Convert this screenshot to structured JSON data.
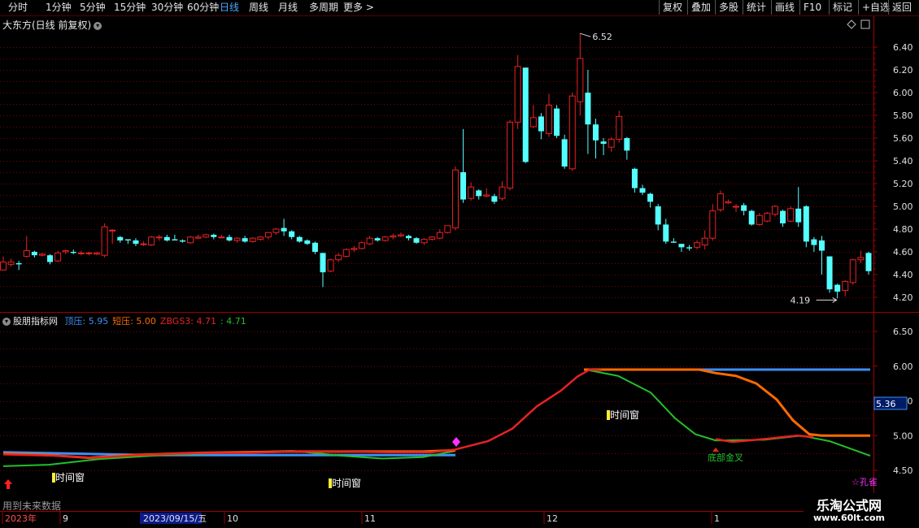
{
  "toolbar": {
    "periods": [
      "分时",
      "1分钟",
      "5分钟",
      "15分钟",
      "30分钟",
      "60分钟",
      "日线",
      "周线",
      "月线",
      "多周期",
      "更多 >"
    ],
    "active_period": "日线",
    "right_buttons": [
      "复权",
      "叠加",
      "多股",
      "统计",
      "画线",
      "F10",
      "标记",
      "+自选",
      "返回"
    ]
  },
  "stock": {
    "title": "大东方(日线 前复权)",
    "high_label": "6.52",
    "low_label": "4.19"
  },
  "price_axis": [
    "6.40",
    "6.20",
    "6.00",
    "5.80",
    "5.60",
    "5.40",
    "5.20",
    "5.00",
    "4.80",
    "4.60",
    "4.40",
    "4.20"
  ],
  "indicator": {
    "name": "股朋指标网",
    "items": [
      {
        "label": "顶压:",
        "value": "5.95",
        "color": "#3d8ff5"
      },
      {
        "label": "短压:",
        "value": "5.00",
        "color": "#ff6a00"
      },
      {
        "label": "ZBGS3:",
        "value": "4.71",
        "color": "#e82222"
      },
      {
        "label": ":",
        "value": "4.71",
        "color": "#22c02a"
      }
    ],
    "axis": [
      "6.50",
      "6.00",
      "5.50",
      "5.00",
      "4.50"
    ],
    "current_value": "5.36",
    "annotations": [
      "时间窗",
      "时间窗",
      "时间窗",
      "底部金叉",
      "孔雀"
    ]
  },
  "time_axis": {
    "labels": [
      "2023年",
      "9",
      "2023/09/15/五",
      "10",
      "11",
      "12",
      "1"
    ]
  },
  "bottom_note": "用到未来数据",
  "watermark": {
    "line1": "乐淘公式网",
    "line2": "www.60lt.com"
  },
  "colors": {
    "up": "#e82222",
    "down": "#54ffff",
    "grid": "#7a0000",
    "axis": "#a00000",
    "blue": "#3d8ff5",
    "orange": "#ff6a00",
    "red": "#e82222",
    "green": "#22c02a"
  },
  "chart_data": {
    "type": "candlestick",
    "series_name": "大东方",
    "candles": [
      [
        4.44,
        4.51,
        4.56,
        4.44
      ],
      [
        4.49,
        4.51,
        4.54,
        4.47
      ],
      [
        4.5,
        4.49,
        4.52,
        4.44
      ],
      [
        4.56,
        4.61,
        4.74,
        4.55
      ],
      [
        4.6,
        4.57,
        4.61,
        4.55
      ],
      [
        4.57,
        4.58,
        4.59,
        4.56
      ],
      [
        4.57,
        4.51,
        4.58,
        4.49
      ],
      [
        4.52,
        4.59,
        4.61,
        4.51
      ],
      [
        4.6,
        4.61,
        4.62,
        4.58
      ],
      [
        4.6,
        4.59,
        4.62,
        4.58
      ],
      [
        4.59,
        4.59,
        4.61,
        4.57
      ],
      [
        4.59,
        4.59,
        4.6,
        4.57
      ],
      [
        4.58,
        4.59,
        4.6,
        4.57
      ],
      [
        4.57,
        4.82,
        4.85,
        4.55
      ],
      [
        4.79,
        4.79,
        4.8,
        4.67
      ],
      [
        4.73,
        4.7,
        4.74,
        4.68
      ],
      [
        4.71,
        4.7,
        4.71,
        4.67
      ],
      [
        4.7,
        4.67,
        4.72,
        4.65
      ],
      [
        4.67,
        4.67,
        4.69,
        4.65
      ],
      [
        4.66,
        4.73,
        4.74,
        4.65
      ],
      [
        4.73,
        4.73,
        4.75,
        4.7
      ],
      [
        4.73,
        4.7,
        4.75,
        4.69
      ],
      [
        4.71,
        4.7,
        4.75,
        4.7
      ],
      [
        4.7,
        4.69,
        4.71,
        4.68
      ],
      [
        4.68,
        4.73,
        4.74,
        4.67
      ],
      [
        4.72,
        4.73,
        4.75,
        4.71
      ],
      [
        4.73,
        4.75,
        4.76,
        4.72
      ],
      [
        4.75,
        4.73,
        4.76,
        4.71
      ],
      [
        4.73,
        4.73,
        4.75,
        4.72
      ],
      [
        4.73,
        4.7,
        4.75,
        4.69
      ],
      [
        4.7,
        4.72,
        4.73,
        4.68
      ],
      [
        4.72,
        4.69,
        4.74,
        4.68
      ],
      [
        4.69,
        4.72,
        4.73,
        4.68
      ],
      [
        4.71,
        4.73,
        4.74,
        4.7
      ],
      [
        4.73,
        4.77,
        4.77,
        4.71
      ],
      [
        4.77,
        4.8,
        4.81,
        4.75
      ],
      [
        4.81,
        4.78,
        4.89,
        4.74
      ],
      [
        4.78,
        4.73,
        4.79,
        4.71
      ],
      [
        4.73,
        4.69,
        4.74,
        4.68
      ],
      [
        4.7,
        4.67,
        4.71,
        4.66
      ],
      [
        4.68,
        4.6,
        4.69,
        4.58
      ],
      [
        4.59,
        4.42,
        4.59,
        4.29
      ],
      [
        4.43,
        4.53,
        4.54,
        4.42
      ],
      [
        4.53,
        4.57,
        4.59,
        4.51
      ],
      [
        4.56,
        4.62,
        4.63,
        4.55
      ],
      [
        4.62,
        4.63,
        4.65,
        4.6
      ],
      [
        4.63,
        4.68,
        4.69,
        4.62
      ],
      [
        4.67,
        4.72,
        4.74,
        4.66
      ],
      [
        4.72,
        4.7,
        4.73,
        4.69
      ],
      [
        4.7,
        4.73,
        4.74,
        4.69
      ],
      [
        4.73,
        4.74,
        4.76,
        4.71
      ],
      [
        4.74,
        4.75,
        4.77,
        4.73
      ],
      [
        4.74,
        4.72,
        4.75,
        4.7
      ],
      [
        4.72,
        4.68,
        4.73,
        4.67
      ],
      [
        4.68,
        4.71,
        4.72,
        4.66
      ],
      [
        4.71,
        4.73,
        4.74,
        4.7
      ],
      [
        4.72,
        4.77,
        4.8,
        4.71
      ],
      [
        4.77,
        4.83,
        4.83,
        4.76
      ],
      [
        4.81,
        5.32,
        5.35,
        4.79
      ],
      [
        5.3,
        5.06,
        5.68,
        5.03
      ],
      [
        5.07,
        5.17,
        5.21,
        5.05
      ],
      [
        5.14,
        5.09,
        5.15,
        5.06
      ],
      [
        5.09,
        5.1,
        5.16,
        5.08
      ],
      [
        5.09,
        5.04,
        5.11,
        5.02
      ],
      [
        5.07,
        5.17,
        5.22,
        5.05
      ],
      [
        5.16,
        5.74,
        5.76,
        5.14
      ],
      [
        5.74,
        6.23,
        6.33,
        5.68
      ],
      [
        6.22,
        5.39,
        5.89,
        5.38
      ],
      [
        5.7,
        5.78,
        5.89,
        5.69
      ],
      [
        5.79,
        5.66,
        5.82,
        5.59
      ],
      [
        5.64,
        5.89,
        5.99,
        5.61
      ],
      [
        5.86,
        5.62,
        5.89,
        5.6
      ],
      [
        5.59,
        5.35,
        5.63,
        5.33
      ],
      [
        5.33,
        5.97,
        6.0,
        5.31
      ],
      [
        5.92,
        6.3,
        6.52,
        5.8
      ],
      [
        6.0,
        5.72,
        6.2,
        5.46
      ],
      [
        5.72,
        5.58,
        5.77,
        5.42
      ],
      [
        5.57,
        5.55,
        5.6,
        5.45
      ],
      [
        5.52,
        5.59,
        5.61,
        5.48
      ],
      [
        5.59,
        5.79,
        5.84,
        5.56
      ],
      [
        5.6,
        5.49,
        5.61,
        5.41
      ],
      [
        5.33,
        5.16,
        5.34,
        5.12
      ],
      [
        5.16,
        5.12,
        5.19,
        5.1
      ],
      [
        5.11,
        5.04,
        5.12,
        4.99
      ],
      [
        5.0,
        4.84,
        5.02,
        4.79
      ],
      [
        4.84,
        4.69,
        4.89,
        4.67
      ],
      [
        4.69,
        4.68,
        4.72,
        4.68
      ],
      [
        4.67,
        4.64,
        4.67,
        4.6
      ],
      [
        4.64,
        4.63,
        4.66,
        4.61
      ],
      [
        4.64,
        4.68,
        4.7,
        4.62
      ],
      [
        4.66,
        4.72,
        4.79,
        4.62
      ],
      [
        4.72,
        4.96,
        5.02,
        4.7
      ],
      [
        4.97,
        5.11,
        5.14,
        4.95
      ],
      [
        5.03,
        5.04,
        5.06,
        5.02
      ],
      [
        5.0,
        5.0,
        5.02,
        4.95
      ],
      [
        5.01,
        4.96,
        5.03,
        4.92
      ],
      [
        4.96,
        4.84,
        4.97,
        4.83
      ],
      [
        4.84,
        4.92,
        4.94,
        4.83
      ],
      [
        4.87,
        4.94,
        4.95,
        4.86
      ],
      [
        4.93,
        5.0,
        5.01,
        4.91
      ],
      [
        4.96,
        4.85,
        4.97,
        4.82
      ],
      [
        4.87,
        4.98,
        5.0,
        4.86
      ],
      [
        4.98,
        4.86,
        5.17,
        4.82
      ],
      [
        5.0,
        4.69,
        5.01,
        4.64
      ],
      [
        4.71,
        4.66,
        4.73,
        4.6
      ],
      [
        4.7,
        4.61,
        4.74,
        4.4
      ],
      [
        4.56,
        4.27,
        4.56,
        4.24
      ],
      [
        4.31,
        4.25,
        4.32,
        4.19
      ],
      [
        4.26,
        4.34,
        4.35,
        4.21
      ],
      [
        4.33,
        4.53,
        4.54,
        4.31
      ],
      [
        4.53,
        4.55,
        4.61,
        4.5
      ],
      [
        4.59,
        4.43,
        4.6,
        4.4
      ]
    ],
    "indicator_series": {
      "top_pressure": "5.95",
      "short_pressure": "5.00",
      "zbgs3": "4.71"
    }
  }
}
